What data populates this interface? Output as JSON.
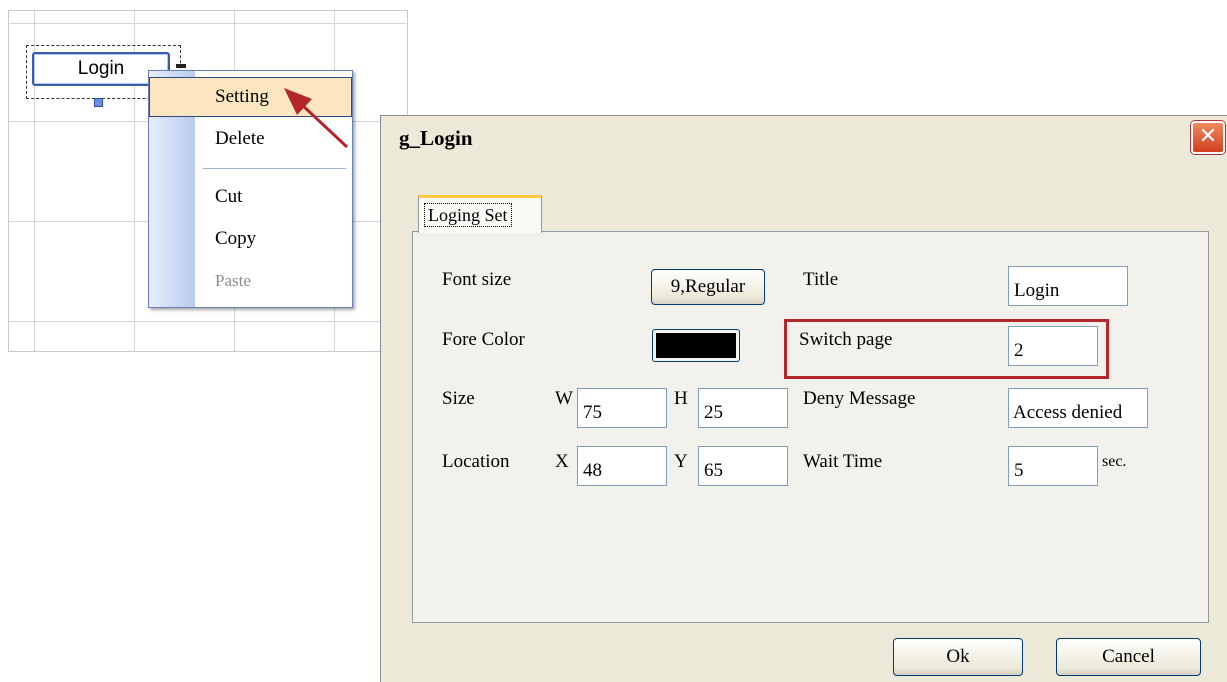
{
  "designer": {
    "login_control_label": "Login"
  },
  "context_menu": {
    "items": [
      {
        "label": "Setting",
        "state": "highlighted"
      },
      {
        "label": "Delete",
        "state": "normal"
      },
      {
        "label": "Cut",
        "state": "normal"
      },
      {
        "label": "Copy",
        "state": "normal"
      },
      {
        "label": "Paste",
        "state": "disabled"
      }
    ]
  },
  "dialog": {
    "title": "g_Login",
    "close_symbol": "✕",
    "tab": "Loging Set",
    "font_size_label": "Font size",
    "font_size_value": "9,Regular",
    "fore_color_label": "Fore Color",
    "fore_color": "#000000",
    "size_label": "Size",
    "w_label": "W",
    "w_value": "75",
    "h_label": "H",
    "h_value": "25",
    "location_label": "Location",
    "x_label": "X",
    "x_value": "48",
    "y_label": "Y",
    "y_value": "65",
    "title_label": "Title",
    "title_value": "Login",
    "switch_page_label": "Switch page",
    "switch_page_value": "2",
    "deny_message_label": "Deny Message",
    "deny_message_value": "Access denied",
    "wait_time_label": "Wait Time",
    "wait_time_value": "5",
    "wait_time_unit": "sec.",
    "ok_label": "Ok",
    "cancel_label": "Cancel"
  },
  "colors": {
    "highlight_border": "#b3262b",
    "arrow": "#b3262b",
    "close_button": "#d0401e"
  }
}
